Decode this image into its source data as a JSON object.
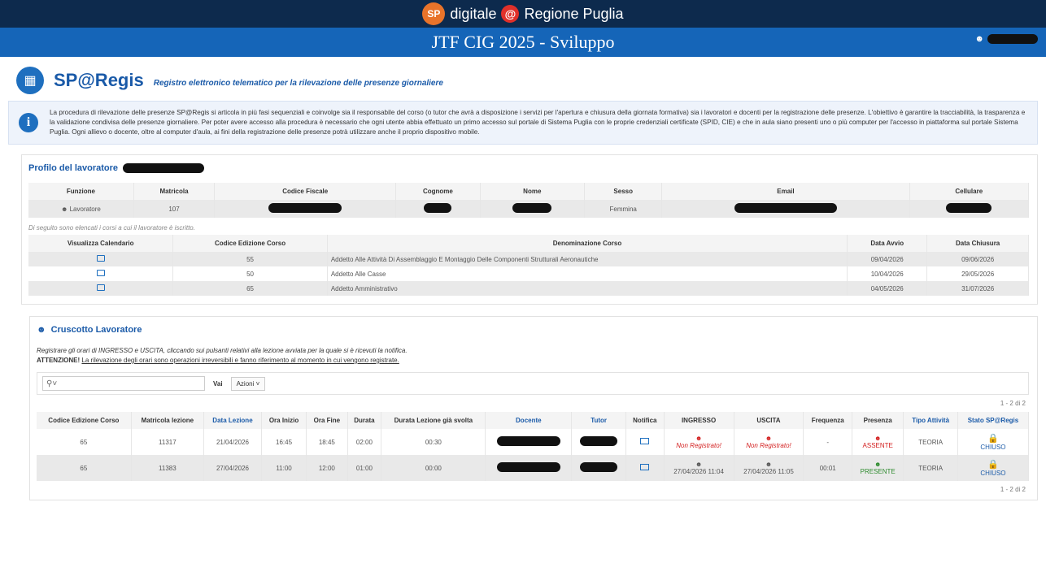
{
  "header": {
    "brand_left": "SP",
    "brand_text_1": "digitale",
    "brand_at": "@",
    "brand_text_2": "Regione Puglia",
    "title": "JTF CIG 2025 - Sviluppo",
    "user_icon": "user-icon"
  },
  "app": {
    "name": "SP@Regis",
    "subtitle": "Registro elettronico telematico per la rilevazione delle presenze giornaliere"
  },
  "info": {
    "text": "La procedura di rilevazione delle presenze SP@Regis si articola in più fasi sequenziali e coinvolge sia il responsabile del corso (o tutor che avrà a disposizione i servizi per l'apertura e chiusura della giornata formativa) sia i lavoratori e docenti per la registrazione delle presenze. L'obiettivo è garantire la tracciabilità, la trasparenza e la validazione condivisa delle presenze giornaliere. Per poter avere accesso alla procedura è necessario che ogni utente abbia effettuato un primo accesso sul portale di Sistema Puglia con le proprie credenziali certificate (SPID, CIE) e che in aula siano presenti uno o più computer per l'accesso in piattaforma sul portale Sistema Puglia. Ogni allievo o docente, oltre al computer d'aula, ai fini della registrazione delle presenze potrà utilizzare anche il proprio dispositivo mobile."
  },
  "profile": {
    "title": "Profilo del lavoratore",
    "headers": [
      "Funzione",
      "Matricola",
      "Codice Fiscale",
      "Cognome",
      "Nome",
      "Sesso",
      "Email",
      "Cellulare"
    ],
    "funzione": "Lavoratore",
    "matricola": "107",
    "sesso": "Femmina"
  },
  "courses": {
    "note": "Di seguito sono elencati i corsi a cui il lavoratore è iscritto.",
    "headers": [
      "Visualizza Calendario",
      "Codice Edizione Corso",
      "Denominazione Corso",
      "Data Avvio",
      "Data Chiusura"
    ],
    "rows": [
      {
        "codice": "55",
        "denominazione": "Addetto Alle Attività Di Assemblaggio E Montaggio Delle Componenti Strutturali Aeronautiche",
        "avvio": "09/04/2026",
        "chiusura": "09/06/2026"
      },
      {
        "codice": "50",
        "denominazione": "Addetto Alle Casse",
        "avvio": "10/04/2026",
        "chiusura": "29/05/2026"
      },
      {
        "codice": "65",
        "denominazione": "Addetto Amministrativo",
        "avvio": "04/05/2026",
        "chiusura": "31/07/2026"
      }
    ]
  },
  "cruscotto": {
    "title": "Cruscotto Lavoratore",
    "line1": "Registrare gli orari di INGRESSO e USCITA, cliccando sui pulsanti relativi alla lezione avviata per la quale si è ricevuti la notifica.",
    "attenzione": "ATTENZIONE!",
    "line2": "La rilevazione degli orari sono operazioni irreversibili e fanno riferimento al momento in cui vengono registrate.",
    "search_placeholder": "",
    "vai": "Vai",
    "azioni": "Azioni",
    "pager": "1 - 2 di 2",
    "headers": [
      "Codice Edizione Corso",
      "Matricola lezione",
      "Data Lezione",
      "Ora Inizio",
      "Ora Fine",
      "Durata",
      "Durata Lezione già svolta",
      "Docente",
      "Tutor",
      "Notifica",
      "INGRESSO",
      "USCITA",
      "Frequenza",
      "Presenza",
      "Tipo Attività",
      "Stato SP@Regis"
    ],
    "rows": [
      {
        "codice": "65",
        "matricola": "11317",
        "data": "21/04/2026",
        "inizio": "16:45",
        "fine": "18:45",
        "durata": "02:00",
        "svolta": "00:30",
        "ingresso": "Non Registrato!",
        "uscita": "Non Registrato!",
        "frequenza": "-",
        "presenza": "ASSENTE",
        "tipo": "TEORIA",
        "stato": "CHIUSO"
      },
      {
        "codice": "65",
        "matricola": "11383",
        "data": "27/04/2026",
        "inizio": "11:00",
        "fine": "12:00",
        "durata": "01:00",
        "svolta": "00:00",
        "ingresso": "27/04/2026 11:04",
        "uscita": "27/04/2026 11:05",
        "frequenza": "00:01",
        "presenza": "PRESENTE",
        "tipo": "TEORIA",
        "stato": "CHIUSO"
      }
    ]
  }
}
